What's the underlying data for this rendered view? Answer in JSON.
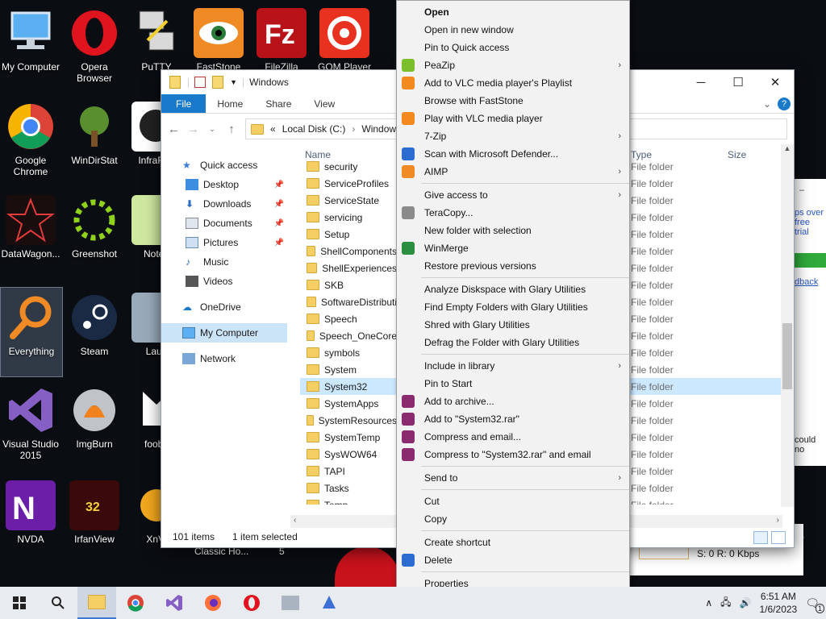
{
  "desktop": {
    "icons": [
      {
        "label": "My Computer"
      },
      {
        "label": "Opera Browser"
      },
      {
        "label": "PuTTY"
      },
      {
        "label": "FastStone"
      },
      {
        "label": "FileZilla"
      },
      {
        "label": "GOM Player"
      },
      {
        "label": "Google Chrome"
      },
      {
        "label": "WinDirStat"
      },
      {
        "label": "InfraRec"
      },
      {
        "label": "DataWagon..."
      },
      {
        "label": "Greenshot"
      },
      {
        "label": "Notep"
      },
      {
        "label": "Everything"
      },
      {
        "label": "Steam"
      },
      {
        "label": "Laun"
      },
      {
        "label": "Visual Studio 2015"
      },
      {
        "label": "ImgBurn"
      },
      {
        "label": "fooba"
      },
      {
        "label": "NVDA"
      },
      {
        "label": "IrfanView"
      },
      {
        "label": "XnVi"
      }
    ],
    "under_window_text_a": "Classic Ho...",
    "under_window_text_b": "5"
  },
  "explorer": {
    "title": "Windows",
    "ribbon_tabs": [
      "File",
      "Home",
      "Share",
      "View"
    ],
    "address": {
      "prefix": "«",
      "parts": [
        "Local Disk (C:)",
        "Windows"
      ]
    },
    "nav": {
      "quick_access": "Quick access",
      "items": [
        "Desktop",
        "Downloads",
        "Documents",
        "Pictures",
        "Music",
        "Videos"
      ],
      "onedrive": "OneDrive",
      "my_computer": "My Computer",
      "network": "Network"
    },
    "columns": {
      "name": "Name",
      "type": "Type",
      "size": "Size"
    },
    "files": [
      "security",
      "ServiceProfiles",
      "ServiceState",
      "servicing",
      "Setup",
      "ShellComponents",
      "ShellExperiences",
      "SKB",
      "SoftwareDistributi",
      "Speech",
      "Speech_OneCore",
      "symbols",
      "System",
      "System32",
      "SystemApps",
      "SystemResources",
      "SystemTemp",
      "SysWOW64",
      "TAPI",
      "Tasks",
      "Temp"
    ],
    "file_type": "File folder",
    "selected_file": "System32",
    "status": {
      "count": "101 items",
      "selected": "1 item selected"
    }
  },
  "context_menu": {
    "groups": [
      [
        {
          "label": "Open",
          "bold": true
        },
        {
          "label": "Open in new window"
        },
        {
          "label": "Pin to Quick access"
        },
        {
          "label": "PeaZip",
          "sub": true,
          "icon": "peazip-icon"
        },
        {
          "label": "Add to VLC media player's Playlist",
          "icon": "vlc-icon"
        },
        {
          "label": "Browse with FastStone"
        },
        {
          "label": "Play with VLC media player",
          "icon": "vlc-icon"
        },
        {
          "label": "7-Zip",
          "sub": true
        },
        {
          "label": "Scan with Microsoft Defender...",
          "icon": "defender-icon"
        },
        {
          "label": "AIMP",
          "sub": true,
          "icon": "aimp-icon"
        }
      ],
      [
        {
          "label": "Give access to",
          "sub": true
        },
        {
          "label": "TeraCopy...",
          "icon": "teracopy-icon"
        },
        {
          "label": "New folder with selection"
        },
        {
          "label": "WinMerge",
          "icon": "winmerge-icon"
        },
        {
          "label": "Restore previous versions"
        }
      ],
      [
        {
          "label": "Analyze Diskspace with Glary Utilities"
        },
        {
          "label": "Find Empty Folders with Glary Utilities"
        },
        {
          "label": "Shred with Glary Utilities"
        },
        {
          "label": "Defrag the Folder with Glary Utilities"
        }
      ],
      [
        {
          "label": "Include in library",
          "sub": true
        },
        {
          "label": "Pin to Start"
        },
        {
          "label": "Add to archive...",
          "icon": "winrar-icon"
        },
        {
          "label": "Add to \"System32.rar\"",
          "icon": "winrar-icon"
        },
        {
          "label": "Compress and email...",
          "icon": "winrar-icon"
        },
        {
          "label": "Compress to \"System32.rar\" and email",
          "icon": "winrar-icon"
        }
      ],
      [
        {
          "label": "Send to",
          "sub": true
        }
      ],
      [
        {
          "label": "Cut"
        },
        {
          "label": "Copy"
        }
      ],
      [
        {
          "label": "Create shortcut"
        },
        {
          "label": "Delete",
          "icon": "shield-icon"
        }
      ],
      [
        {
          "label": "Properties"
        }
      ]
    ]
  },
  "background_window": {
    "line1": "ps over",
    "line2": "free trial",
    "link": "dback",
    "line3": "could no",
    "footer_left": "",
    "speed": "S: 0 R: 0 Kbps",
    "trailing": "er"
  },
  "taskbar": {
    "time": "6:51 AM",
    "date": "1/6/2023",
    "notification_count": "1"
  },
  "colors": {
    "accent": "#1979ca",
    "selection": "#cce8ff",
    "menu_bg": "#f2f2f2"
  }
}
